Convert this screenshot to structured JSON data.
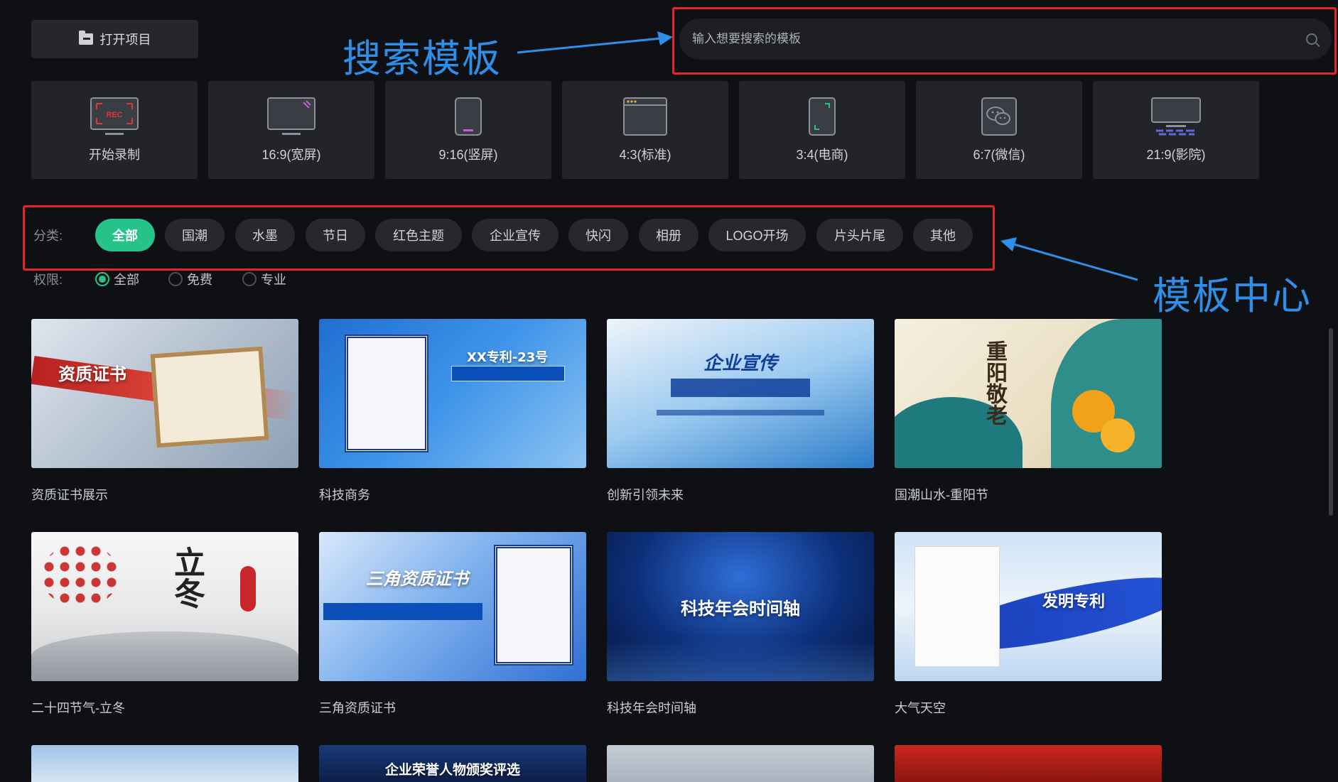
{
  "open_project": {
    "label": "打开项目",
    "icon": "folder-icon"
  },
  "search": {
    "placeholder": "输入想要搜索的模板",
    "icon": "search-icon"
  },
  "annotations": {
    "search_label": "搜索模板",
    "category_label": "模板中心",
    "color": "#2f8fe8",
    "frame_color": "#e2262a"
  },
  "aspect_tiles": [
    {
      "label": "开始录制",
      "icon": "record-screen-icon"
    },
    {
      "label": "16:9(宽屏)",
      "icon": "widescreen-icon"
    },
    {
      "label": "9:16(竖屏)",
      "icon": "portrait-phone-icon"
    },
    {
      "label": "4:3(标准)",
      "icon": "standard-window-icon"
    },
    {
      "label": "3:4(电商)",
      "icon": "ecommerce-phone-icon"
    },
    {
      "label": "6:7(微信)",
      "icon": "wechat-icon"
    },
    {
      "label": "21:9(影院)",
      "icon": "cinema-icon"
    }
  ],
  "categories": {
    "label": "分类:",
    "items": [
      "全部",
      "国潮",
      "水墨",
      "节日",
      "红色主题",
      "企业宣传",
      "快闪",
      "相册",
      "LOGO开场",
      "片头片尾",
      "其他"
    ],
    "active": "全部",
    "accent": "#25c289"
  },
  "permissions": {
    "label": "权限:",
    "options": [
      "全部",
      "免费",
      "专业"
    ],
    "selected": "全部"
  },
  "templates": [
    {
      "title": "资质证书展示",
      "thumb_text": "资质证书"
    },
    {
      "title": "科技商务",
      "thumb_text": "XX专利-23号"
    },
    {
      "title": "创新引领未来",
      "thumb_text": "企业宣传"
    },
    {
      "title": "国潮山水-重阳节",
      "thumb_text": "重阳敬老"
    },
    {
      "title": "二十四节气-立冬",
      "thumb_text": "立冬"
    },
    {
      "title": "三角资质证书",
      "thumb_text": "三角资质证书"
    },
    {
      "title": "科技年会时间轴",
      "thumb_text": "科技年会时间轴"
    },
    {
      "title": "大气天空",
      "thumb_text": "发明专利"
    }
  ],
  "partial_row": {
    "thumb_text": "企业荣誉人物颁奖评选"
  }
}
